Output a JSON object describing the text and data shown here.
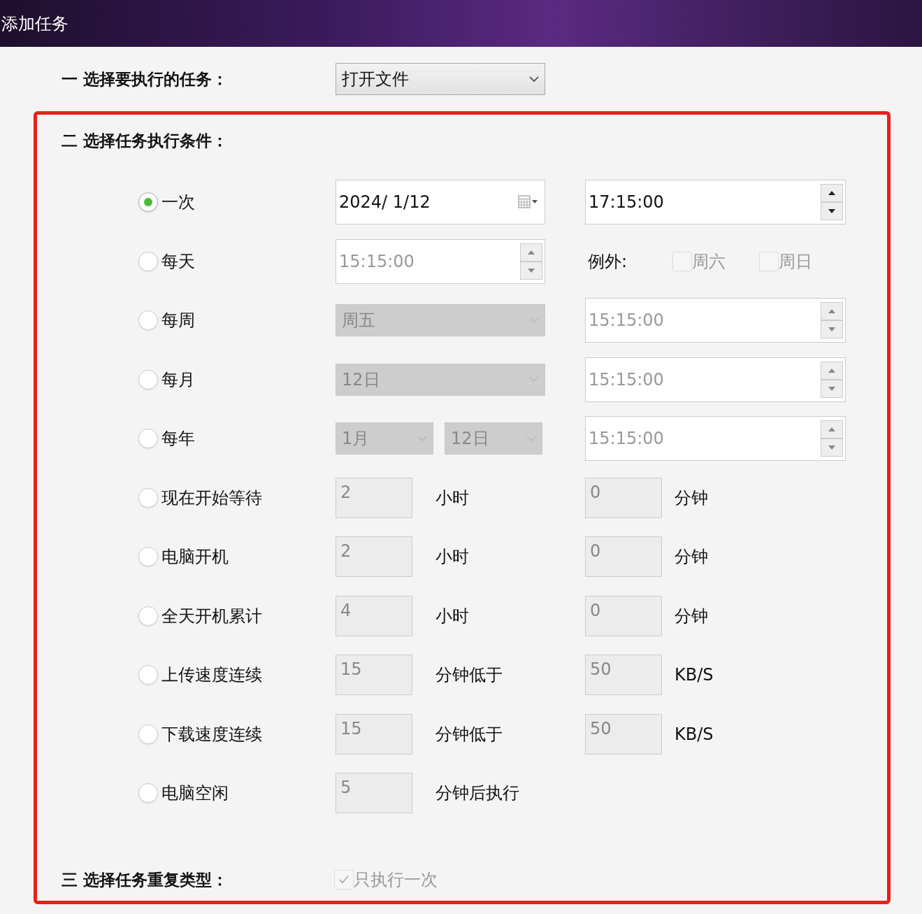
{
  "window": {
    "title": "添加任务"
  },
  "task": {
    "label": "一 选择要执行的任务：",
    "dropdown": {
      "value": "打开文件",
      "disabled": false
    }
  },
  "conditions": {
    "label": "二 选择任务执行条件：",
    "rows": [
      {
        "label": "一次",
        "selected": true,
        "left": [
          {
            "kind": "date",
            "value": "2024/  1/12",
            "disabled": false
          }
        ],
        "right": [
          {
            "kind": "time",
            "value": "17:15:00",
            "disabled": false
          }
        ]
      },
      {
        "label": "每天",
        "selected": false,
        "left": [
          {
            "kind": "time",
            "value": "15:15:00",
            "disabled": true
          }
        ],
        "right": [
          {
            "kind": "label",
            "text": "例外:"
          },
          {
            "kind": "checkbox",
            "label": "周六",
            "checked": false,
            "disabled": true
          },
          {
            "kind": "checkbox",
            "label": "周日",
            "checked": false,
            "disabled": true
          }
        ]
      },
      {
        "label": "每周",
        "selected": false,
        "left": [
          {
            "kind": "dropdown",
            "value": "周五",
            "disabled": true
          }
        ],
        "right": [
          {
            "kind": "time",
            "value": "15:15:00",
            "disabled": true
          }
        ]
      },
      {
        "label": "每月",
        "selected": false,
        "left": [
          {
            "kind": "dropdown",
            "value": "12日",
            "disabled": true
          }
        ],
        "right": [
          {
            "kind": "time",
            "value": "15:15:00",
            "disabled": true
          }
        ]
      },
      {
        "label": "每年",
        "selected": false,
        "left": [
          {
            "kind": "dropdown",
            "value": "1月",
            "disabled": true
          },
          {
            "kind": "dropdown",
            "value": "12日",
            "disabled": true
          }
        ],
        "right": [
          {
            "kind": "time",
            "value": "15:15:00",
            "disabled": true
          }
        ]
      },
      {
        "label": "现在开始等待",
        "selected": false,
        "left": [
          {
            "kind": "number",
            "value": "2",
            "disabled": true
          },
          {
            "kind": "unit",
            "text": "小时"
          }
        ],
        "right": [
          {
            "kind": "number",
            "value": "0",
            "disabled": true
          },
          {
            "kind": "unit",
            "text": "分钟"
          }
        ]
      },
      {
        "label": "电脑开机",
        "selected": false,
        "left": [
          {
            "kind": "number",
            "value": "2",
            "disabled": true
          },
          {
            "kind": "unit",
            "text": "小时"
          }
        ],
        "right": [
          {
            "kind": "number",
            "value": "0",
            "disabled": true
          },
          {
            "kind": "unit",
            "text": "分钟"
          }
        ]
      },
      {
        "label": "全天开机累计",
        "selected": false,
        "left": [
          {
            "kind": "number",
            "value": "4",
            "disabled": true
          },
          {
            "kind": "unit",
            "text": "小时"
          }
        ],
        "right": [
          {
            "kind": "number",
            "value": "0",
            "disabled": true
          },
          {
            "kind": "unit",
            "text": "分钟"
          }
        ]
      },
      {
        "label": "上传速度连续",
        "selected": false,
        "left": [
          {
            "kind": "number",
            "value": "15",
            "disabled": true
          },
          {
            "kind": "unit",
            "text": "分钟低于"
          }
        ],
        "right": [
          {
            "kind": "number",
            "value": "50",
            "disabled": true
          },
          {
            "kind": "unit",
            "text": "KB/S"
          }
        ]
      },
      {
        "label": "下载速度连续",
        "selected": false,
        "left": [
          {
            "kind": "number",
            "value": "15",
            "disabled": true
          },
          {
            "kind": "unit",
            "text": "分钟低于"
          }
        ],
        "right": [
          {
            "kind": "number",
            "value": "50",
            "disabled": true
          },
          {
            "kind": "unit",
            "text": "KB/S"
          }
        ]
      },
      {
        "label": "电脑空闲",
        "selected": false,
        "left": [
          {
            "kind": "number",
            "value": "5",
            "disabled": true
          },
          {
            "kind": "unit",
            "text": "分钟后执行"
          }
        ]
      }
    ]
  },
  "repeat": {
    "label": "三 选择任务重复类型：",
    "checkbox": {
      "label": "只执行一次",
      "checked": true,
      "disabled": true
    }
  }
}
